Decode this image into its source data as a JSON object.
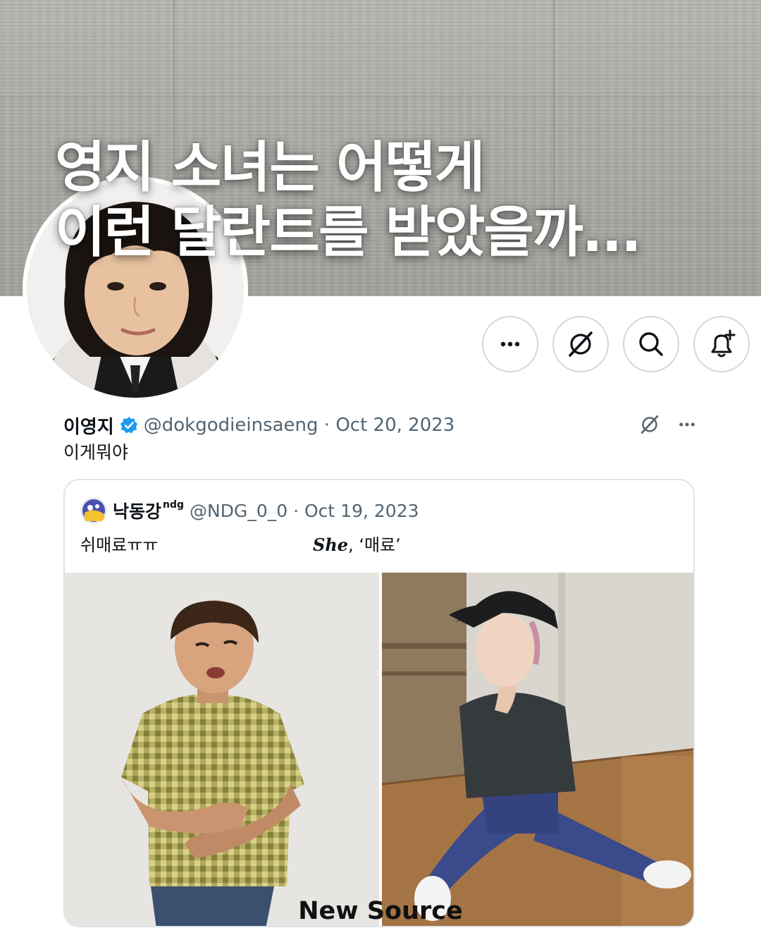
{
  "headline": {
    "line1": "영지 소녀는 어떻게",
    "line2": "이런 달란트를 받았을까..."
  },
  "profile": {
    "avatar_icon": "profile-photo",
    "actions": [
      {
        "name": "more-options",
        "icon": "ellipsis-icon"
      },
      {
        "name": "grok",
        "icon": "grok-icon"
      },
      {
        "name": "search",
        "icon": "search-icon"
      },
      {
        "name": "notifications",
        "icon": "bell-plus-icon"
      }
    ]
  },
  "tweet": {
    "display_name": "이영지",
    "verified": true,
    "meta": "@dokgodieinsaeng · Oct 20, 2023",
    "text": "이게뭐야"
  },
  "quote": {
    "display_name": "낙동강",
    "name_suffix": "ndg",
    "meta": "@NDG_0_0 · Oct 19, 2023",
    "text": "쉬매료ㅠㅠ",
    "caption_bold": "She",
    "caption_rest": ", ‘매료’"
  },
  "watermark": "New Source",
  "colors": {
    "text_primary": "#0f1419",
    "text_secondary": "#536471",
    "verified_blue": "#1d9bf0",
    "border": "#cfd9de"
  }
}
